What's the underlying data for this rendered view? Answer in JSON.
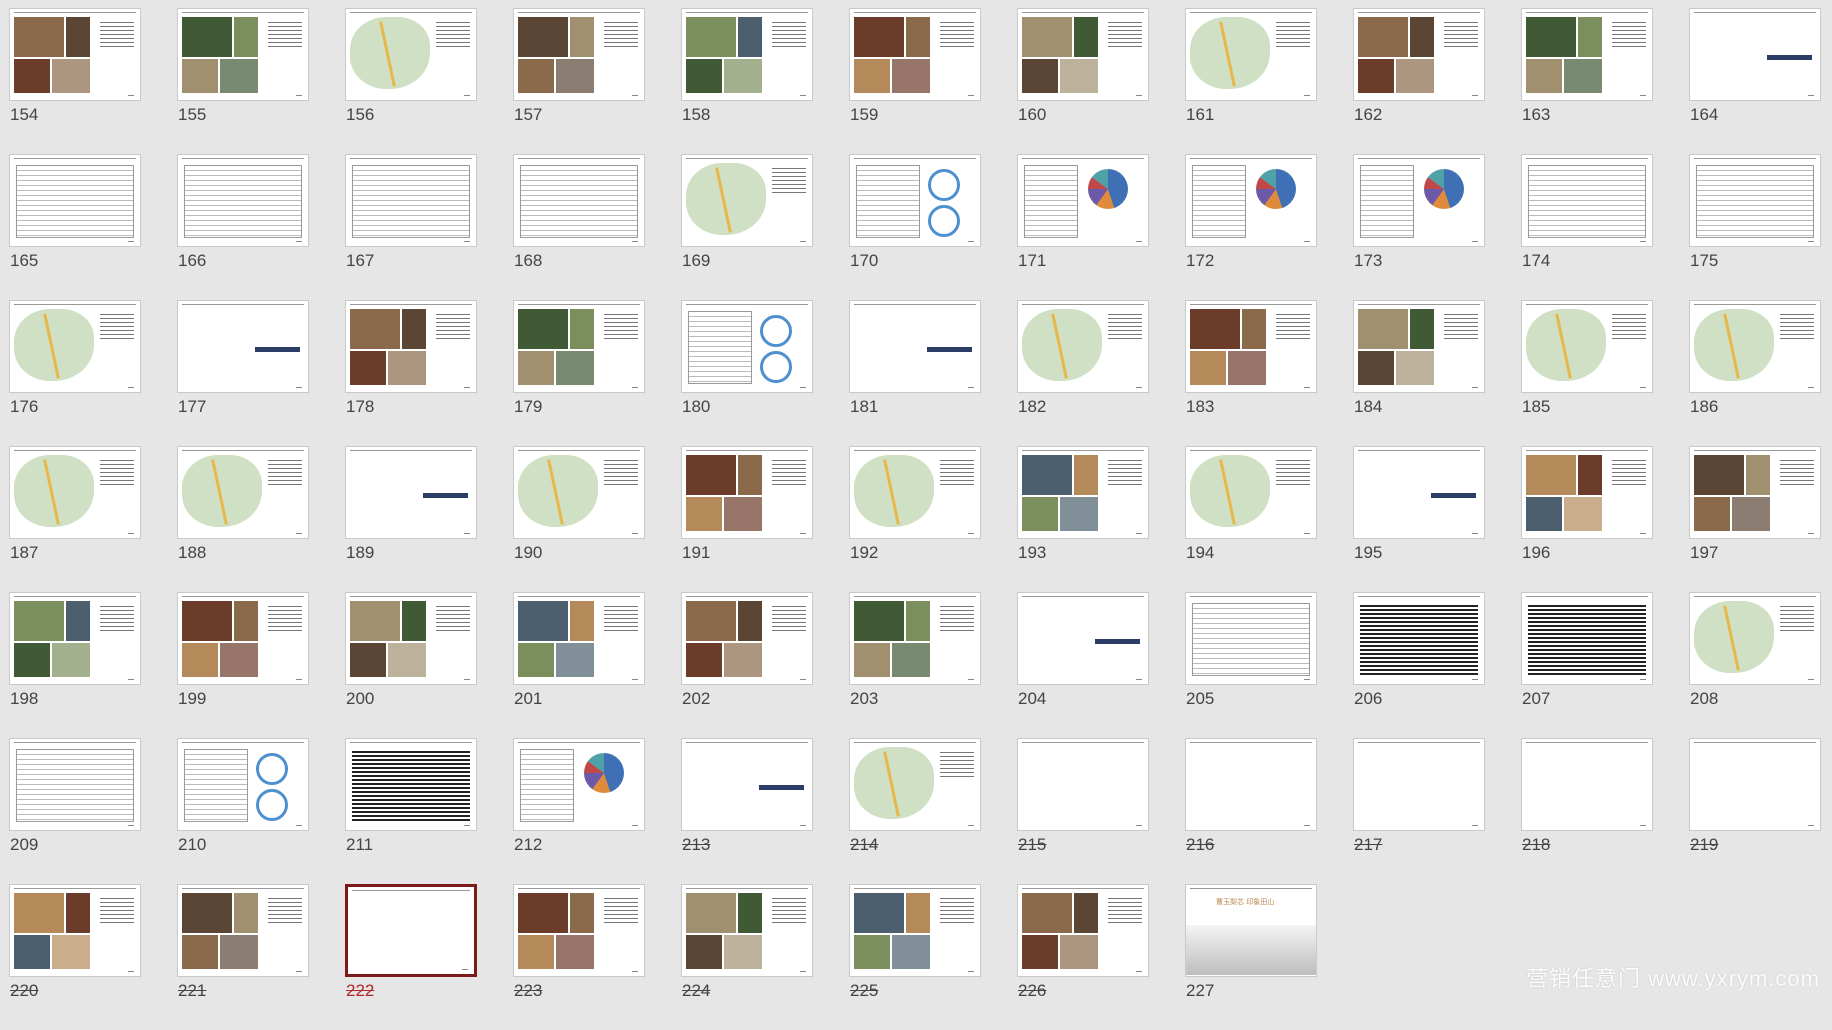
{
  "slides": [
    {
      "n": "154",
      "kind": "photos"
    },
    {
      "n": "155",
      "kind": "photos"
    },
    {
      "n": "156",
      "kind": "map"
    },
    {
      "n": "157",
      "kind": "photos"
    },
    {
      "n": "158",
      "kind": "photos"
    },
    {
      "n": "159",
      "kind": "photos"
    },
    {
      "n": "160",
      "kind": "photos"
    },
    {
      "n": "161",
      "kind": "map"
    },
    {
      "n": "162",
      "kind": "photos"
    },
    {
      "n": "163",
      "kind": "photos"
    },
    {
      "n": "164",
      "kind": "bar"
    },
    {
      "n": "165",
      "kind": "table"
    },
    {
      "n": "166",
      "kind": "table"
    },
    {
      "n": "167",
      "kind": "table"
    },
    {
      "n": "168",
      "kind": "table"
    },
    {
      "n": "169",
      "kind": "map"
    },
    {
      "n": "170",
      "kind": "chart"
    },
    {
      "n": "171",
      "kind": "pie"
    },
    {
      "n": "172",
      "kind": "pie"
    },
    {
      "n": "173",
      "kind": "pie"
    },
    {
      "n": "174",
      "kind": "table"
    },
    {
      "n": "175",
      "kind": "table"
    },
    {
      "n": "176",
      "kind": "map"
    },
    {
      "n": "177",
      "kind": "bar"
    },
    {
      "n": "178",
      "kind": "photos"
    },
    {
      "n": "179",
      "kind": "photos"
    },
    {
      "n": "180",
      "kind": "chart"
    },
    {
      "n": "181",
      "kind": "bar"
    },
    {
      "n": "182",
      "kind": "map"
    },
    {
      "n": "183",
      "kind": "photos"
    },
    {
      "n": "184",
      "kind": "photos"
    },
    {
      "n": "185",
      "kind": "map"
    },
    {
      "n": "186",
      "kind": "map"
    },
    {
      "n": "187",
      "kind": "map"
    },
    {
      "n": "188",
      "kind": "map"
    },
    {
      "n": "189",
      "kind": "bar"
    },
    {
      "n": "190",
      "kind": "map"
    },
    {
      "n": "191",
      "kind": "photos"
    },
    {
      "n": "192",
      "kind": "map"
    },
    {
      "n": "193",
      "kind": "photos"
    },
    {
      "n": "194",
      "kind": "map"
    },
    {
      "n": "195",
      "kind": "bar"
    },
    {
      "n": "196",
      "kind": "photos"
    },
    {
      "n": "197",
      "kind": "photos"
    },
    {
      "n": "198",
      "kind": "photos"
    },
    {
      "n": "199",
      "kind": "photos"
    },
    {
      "n": "200",
      "kind": "photos"
    },
    {
      "n": "201",
      "kind": "photos"
    },
    {
      "n": "202",
      "kind": "photos"
    },
    {
      "n": "203",
      "kind": "photos"
    },
    {
      "n": "204",
      "kind": "bar"
    },
    {
      "n": "205",
      "kind": "table"
    },
    {
      "n": "206",
      "kind": "text"
    },
    {
      "n": "207",
      "kind": "text"
    },
    {
      "n": "208",
      "kind": "map"
    },
    {
      "n": "209",
      "kind": "table"
    },
    {
      "n": "210",
      "kind": "chart"
    },
    {
      "n": "211",
      "kind": "text"
    },
    {
      "n": "212",
      "kind": "pie"
    },
    {
      "n": "213",
      "kind": "bar",
      "hidden": true
    },
    {
      "n": "214",
      "kind": "map",
      "hidden": true
    },
    {
      "n": "215",
      "kind": "blank",
      "hidden": true
    },
    {
      "n": "216",
      "kind": "blank",
      "hidden": true
    },
    {
      "n": "217",
      "kind": "blank",
      "hidden": true
    },
    {
      "n": "218",
      "kind": "blank",
      "hidden": true
    },
    {
      "n": "219",
      "kind": "blank",
      "hidden": true
    },
    {
      "n": "220",
      "kind": "photos",
      "hidden": true
    },
    {
      "n": "221",
      "kind": "photos",
      "hidden": true
    },
    {
      "n": "222",
      "kind": "blank",
      "hidden": true,
      "selected": true
    },
    {
      "n": "223",
      "kind": "photos",
      "hidden": true
    },
    {
      "n": "224",
      "kind": "photos",
      "hidden": true
    },
    {
      "n": "225",
      "kind": "photos",
      "hidden": true
    },
    {
      "n": "226",
      "kind": "photos",
      "hidden": true
    },
    {
      "n": "227",
      "kind": "cover"
    }
  ],
  "cover_title": "曹玉梨芯 印象田山",
  "watermark": "营销任意门 www.yxrym.com",
  "colors": {
    "selected_border": "#7c1a1a",
    "selected_number": "#b02a2a",
    "background": "#e6e6e6"
  }
}
